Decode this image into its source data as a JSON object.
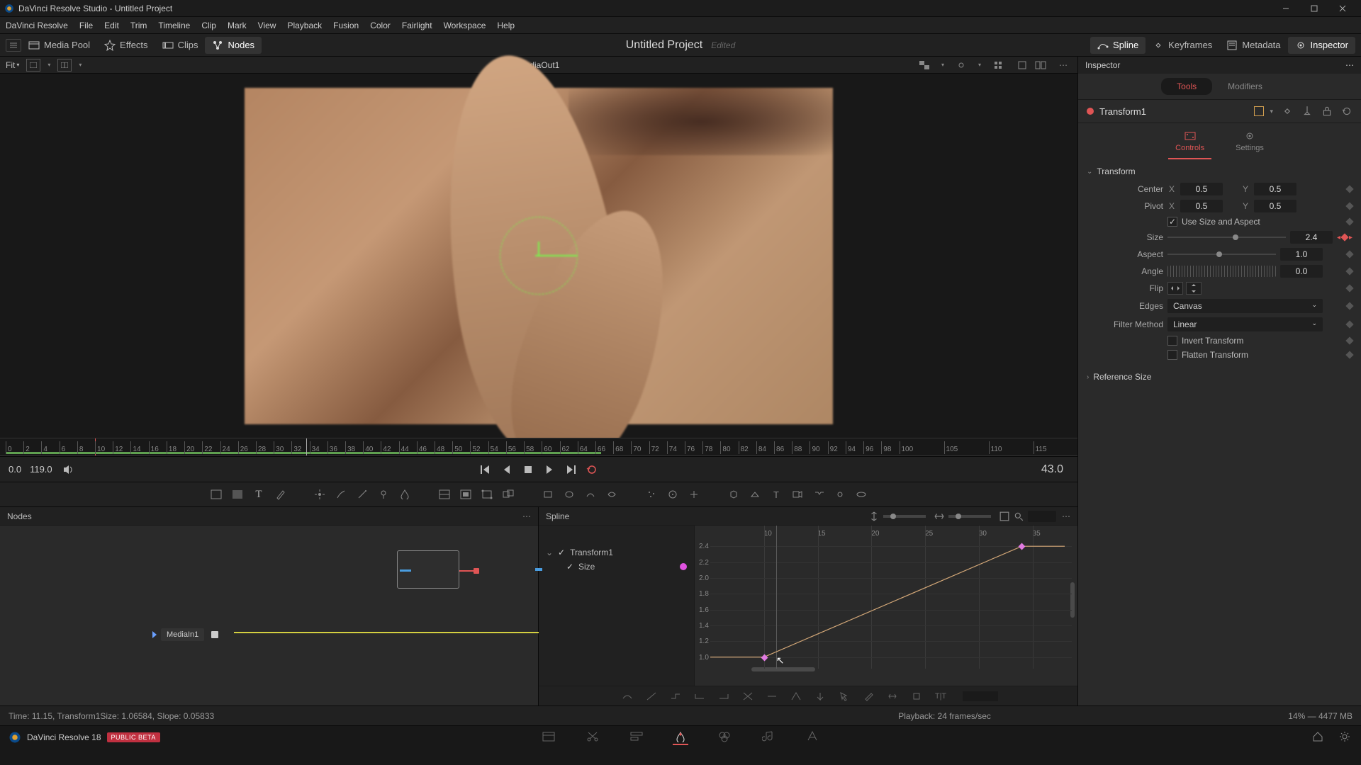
{
  "window": {
    "title": "DaVinci Resolve Studio - Untitled Project"
  },
  "menu": [
    "DaVinci Resolve",
    "File",
    "Edit",
    "Trim",
    "Timeline",
    "Clip",
    "Mark",
    "View",
    "Playback",
    "Fusion",
    "Color",
    "Fairlight",
    "Workspace",
    "Help"
  ],
  "toolbar": {
    "mediapool": "Media Pool",
    "effects": "Effects",
    "clips": "Clips",
    "nodes": "Nodes",
    "project": "Untitled Project",
    "edited": "Edited",
    "spline": "Spline",
    "keyframes": "Keyframes",
    "metadata": "Metadata",
    "inspector": "Inspector"
  },
  "viewer": {
    "fit": "Fit",
    "source": "MediaOut1"
  },
  "ruler": {
    "ticks": [
      0,
      2,
      4,
      6,
      8,
      10,
      12,
      14,
      16,
      18,
      20,
      22,
      24,
      26,
      28,
      30,
      32,
      34,
      36,
      38,
      40,
      42,
      44,
      46,
      48,
      50,
      52,
      54,
      56,
      58,
      60,
      62,
      64,
      66,
      68,
      70,
      72,
      74,
      76,
      78,
      80,
      82,
      84,
      86,
      88,
      90,
      92,
      94,
      96,
      98,
      100,
      105,
      110,
      115
    ],
    "playhead": 43,
    "in": 0,
    "out": 63
  },
  "transport": {
    "in": "0.0",
    "out": "119.0",
    "current": "43.0"
  },
  "nodes_panel": {
    "title": "Nodes",
    "media_node": "MediaIn1"
  },
  "spline": {
    "title": "Spline",
    "tree": {
      "node": "Transform1",
      "param": "Size"
    },
    "xticks": [
      10,
      15,
      20,
      25,
      30,
      35
    ],
    "yticks": [
      "2.4",
      "2.2",
      "2.0",
      "1.8",
      "1.6",
      "1.4",
      "1.2",
      "1.0"
    ]
  },
  "inspector": {
    "title": "Inspector",
    "tabs": {
      "tools": "Tools",
      "modifiers": "Modifiers"
    },
    "node": "Transform1",
    "subtabs": {
      "controls": "Controls",
      "settings": "Settings"
    },
    "sections": {
      "transform": "Transform",
      "refsize": "Reference Size"
    },
    "props": {
      "center_label": "Center",
      "center_x": "0.5",
      "center_y": "0.5",
      "pivot_label": "Pivot",
      "pivot_x": "0.5",
      "pivot_y": "0.5",
      "usesize_label": "Use Size and Aspect",
      "size_label": "Size",
      "size_val": "2.4",
      "aspect_label": "Aspect",
      "aspect_val": "1.0",
      "angle_label": "Angle",
      "angle_val": "0.0",
      "flip_label": "Flip",
      "edges_label": "Edges",
      "edges_val": "Canvas",
      "filter_label": "Filter Method",
      "filter_val": "Linear",
      "invert_label": "Invert Transform",
      "flatten_label": "Flatten Transform"
    }
  },
  "status": {
    "left": "Time: 11.15,    Transform1Size:    1.06584,    Slope: 0.05833",
    "playback": "Playback: 24 frames/sec",
    "mem": "14% — 4477 MB"
  },
  "footer": {
    "app": "DaVinci Resolve 18",
    "beta": "PUBLIC BETA"
  }
}
